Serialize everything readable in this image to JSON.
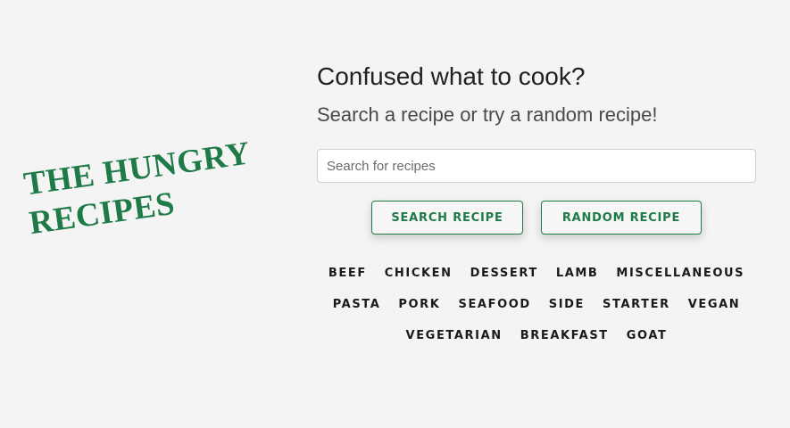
{
  "logo": {
    "line1": "THE HUNGRY",
    "line2": "RECIPES",
    "color": "#1e7a46"
  },
  "hero": {
    "heading": "Confused what to cook?",
    "subheading": "Search a recipe or try a random recipe!"
  },
  "search": {
    "placeholder": "Search for recipes",
    "value": ""
  },
  "buttons": {
    "search_label": "SEARCH RECIPE",
    "random_label": "RANDOM RECIPE"
  },
  "categories": {
    "row1": [
      "BEEF",
      "CHICKEN",
      "DESSERT",
      "LAMB",
      "MISCELLANEOUS"
    ],
    "row2": [
      "PASTA",
      "PORK",
      "SEAFOOD",
      "SIDE",
      "STARTER",
      "VEGAN"
    ],
    "row3": [
      "VEGETARIAN",
      "BREAKFAST",
      "GOAT"
    ]
  },
  "colors": {
    "accent": "#1e7a46",
    "background": "#f4f4f4"
  }
}
